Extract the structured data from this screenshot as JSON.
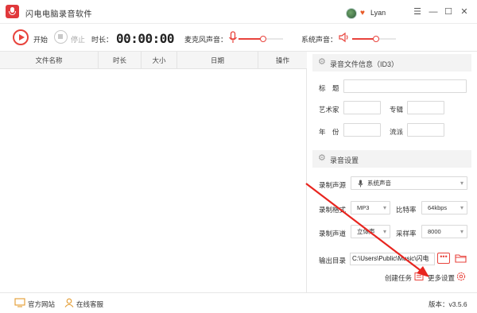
{
  "app": {
    "title": "闪电电脑录音软件",
    "user": "Lyan"
  },
  "window_controls": {
    "menu": "☰",
    "minimize": "—",
    "maximize": "☐",
    "close": "✕"
  },
  "toolbar": {
    "start_label": "开始",
    "stop_label": "停止",
    "duration_label": "时长：",
    "duration_value": "00:00:00",
    "mic_label": "麦克风声音：",
    "system_label": "系统声音：",
    "mic_volume": 0.55,
    "system_volume": 0.55
  },
  "table": {
    "columns": [
      "文件名称",
      "时长",
      "大小",
      "日期",
      "操作"
    ],
    "rows": []
  },
  "id3": {
    "header": "录音文件信息（ID3）",
    "title_label": "标　题",
    "artist_label": "艺术家",
    "album_label": "专辑",
    "year_label": "年　份",
    "genre_label": "流派"
  },
  "settings": {
    "header": "录音设置",
    "source_label": "录制声源",
    "source_value": "系统声音",
    "format_label": "录制格式",
    "format_value": "MP3",
    "bitrate_label": "比特率",
    "bitrate_value": "64kbps",
    "channel_label": "录制声道",
    "channel_value": "立体声",
    "samplerate_label": "采样率",
    "samplerate_value": "8000",
    "output_label": "输出目录",
    "output_path": "C:\\Users\\Public\\Music\\闪电",
    "create_task": "创建任务",
    "more_settings": "更多设置"
  },
  "status": {
    "website": "官方网站",
    "support": "在线客服",
    "version": "版本：v3.5.6"
  },
  "colors": {
    "accent": "#e8433c",
    "logo": "#e0383b",
    "arrow": "#e8251f"
  },
  "icons": [
    "app-logo",
    "avatar",
    "vip-icon",
    "menu-icon",
    "minimize-icon",
    "maximize-icon",
    "close-icon",
    "record-icon",
    "stop-icon",
    "microphone-icon",
    "speaker-icon",
    "gear-icon",
    "folder-icon",
    "task-icon",
    "settings-icon",
    "monitor-icon",
    "support-icon"
  ]
}
